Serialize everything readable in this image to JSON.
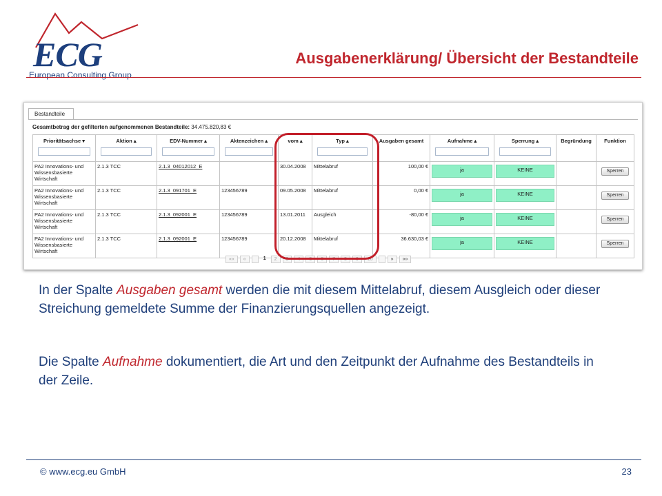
{
  "logo": {
    "text": "ECG",
    "subtitle": "European Consulting Group"
  },
  "title": "Ausgabenerklärung/ Übersicht der Bestandteile",
  "panel": {
    "tab_label": "Bestandteile",
    "total_label": "Gesamtbetrag der gefilterten aufgenommenen Bestandteile:",
    "total_value": "34.475.820,83 €",
    "columns": [
      "Prioritätsachse ▾",
      "Aktion ▴",
      "EDV-Nummer ▴",
      "Aktenzeichen ▴",
      "vom ▴",
      "Typ ▴",
      "Ausgaben gesamt",
      "Aufnahme ▴",
      "Sperrung ▴",
      "Begründung",
      "Funktion"
    ],
    "rows": [
      {
        "prio": "PA2 Innovations- und Wissensbasierte Wirtschaft",
        "aktion": "2.1.3 TCC",
        "edv": "2.1.3_04012012_E",
        "akten": "",
        "vom": "30.04.2008",
        "typ": "Mittelabruf",
        "ausgaben": "100,00 €",
        "aufnahme": "ja",
        "sperrung": "KEINE",
        "begruendung": "",
        "funktion": "Sperren"
      },
      {
        "prio": "PA2 Innovations- und Wissensbasierte Wirtschaft",
        "aktion": "2.1.3 TCC",
        "edv": "2.1.3_091701_E",
        "akten": "123456789",
        "vom": "09.05.2008",
        "typ": "Mittelabruf",
        "ausgaben": "0,00 €",
        "aufnahme": "ja",
        "sperrung": "KEINE",
        "begruendung": "",
        "funktion": "Sperren"
      },
      {
        "prio": "PA2 Innovations- und Wissensbasierte Wirtschaft",
        "aktion": "2.1.3 TCC",
        "edv": "2.1.3_092001_E",
        "akten": "123456789",
        "vom": "13.01.2011",
        "typ": "Ausgleich",
        "ausgaben": "-80,00 €",
        "aufnahme": "ja",
        "sperrung": "KEINE",
        "begruendung": "",
        "funktion": "Sperren"
      },
      {
        "prio": "PA2 Innovations- und Wissensbasierte Wirtschaft",
        "aktion": "2.1.3 TCC",
        "edv": "2.1.3_092001_E",
        "akten": "123456789",
        "vom": "20.12.2008",
        "typ": "Mittelabruf",
        "ausgaben": "36.630,03 €",
        "aufnahme": "ja",
        "sperrung": "KEINE",
        "begruendung": "",
        "funktion": "Sperren"
      }
    ],
    "pager": [
      "««",
      "«",
      "",
      "1",
      "2",
      "3",
      "4",
      "5",
      "6",
      "7",
      "8",
      "9",
      "10",
      "",
      "»",
      "»»"
    ]
  },
  "text": {
    "p1_a": "In der Spalte ",
    "p1_em": "Ausgaben gesamt",
    "p1_b": " werden die mit diesem Mittelabruf, diesem Ausgleich oder dieser Streichung gemeldete Summe der Finanzierungsquellen angezeigt.",
    "p2_a": "Die Spalte ",
    "p2_em": "Aufnahme",
    "p2_b": " dokumentiert, die Art und den Zeitpunkt der Aufnahme des Bestandteils in der Zeile."
  },
  "footer": {
    "copyright": "© www.ecg.eu GmbH",
    "page": "23"
  },
  "colors": {
    "brand_red": "#c0262d",
    "brand_blue": "#1f3f7a",
    "accept_green": "#8ff0c6"
  }
}
